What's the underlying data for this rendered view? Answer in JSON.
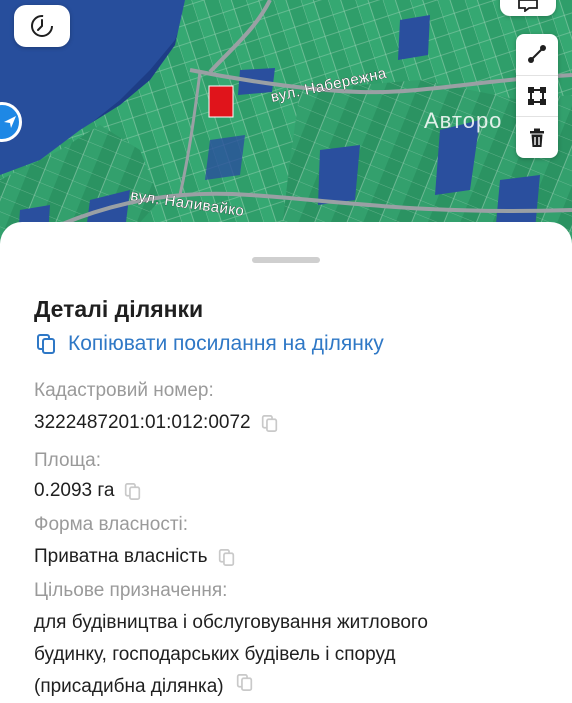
{
  "map": {
    "streets": [
      "вул. Набережна",
      "вул. Наливайко"
    ],
    "district_label": "Авторо",
    "selected_parcel_color": "#e0141b"
  },
  "controls": {
    "history_icon": "history-icon",
    "top_right_icon": "chat-icon",
    "location_icon": "navigation-icon",
    "tools": [
      "ruler-icon",
      "polygon-icon",
      "trash-icon"
    ]
  },
  "details": {
    "title": "Деталі ділянки",
    "copy_link_label": "Копіювати посилання на ділянку",
    "cadastral_label": "Кадастровий номер:",
    "cadastral_value": "3222487201:01:012:0072",
    "area_label": "Площа:",
    "area_value": "0.2093 га",
    "ownership_label": "Форма власності:",
    "ownership_value": "Приватна власність",
    "purpose_label": "Цільове призначення:",
    "purpose_lines": [
      "для будівництва і обслуговування житлового",
      "будинку, господарських будівель і споруд",
      "(присадибна ділянка)"
    ]
  },
  "colors": {
    "accent": "#2f78c6",
    "secondary_text": "#9a9a9a",
    "parcel_green": "#2f9e6a",
    "parcel_blue": "#2a4f9e"
  }
}
